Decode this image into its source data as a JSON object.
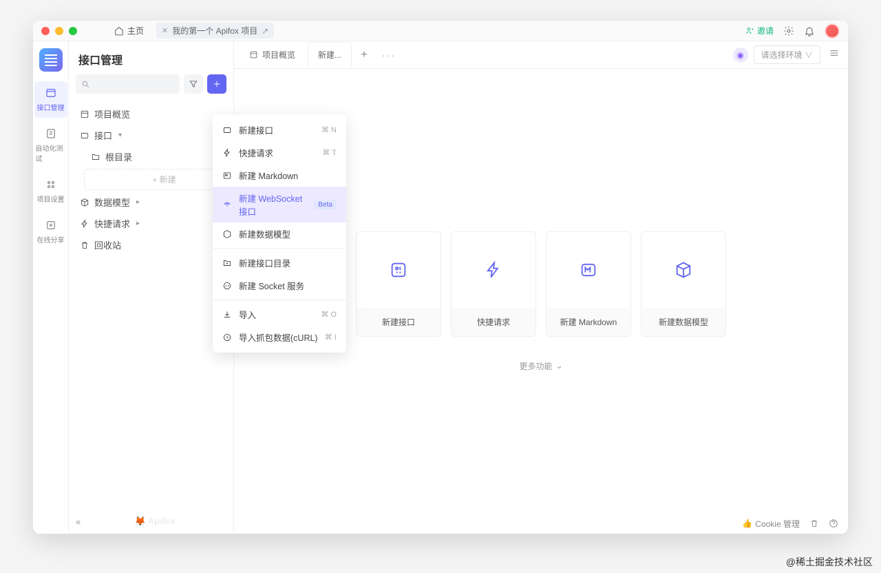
{
  "titlebar": {
    "home": "主页",
    "project_tab": "我的第一个 Apifox 项目",
    "invite": "邀请"
  },
  "nav": {
    "items": [
      "接口管理",
      "自动化测试",
      "项目设置",
      "在线分享"
    ]
  },
  "sidebar": {
    "title": "接口管理",
    "tree": {
      "overview": "项目概览",
      "interface": "接口",
      "root_dir": "根目录",
      "new_placeholder": "+ 新建",
      "data_model": "数据模型",
      "quick_request": "快捷请求",
      "recycle": "回收站"
    },
    "brand": "Apifox"
  },
  "tabs": {
    "overview": "项目概览",
    "new": "新建...",
    "env_placeholder": "请选择环境"
  },
  "dropdown": {
    "items": [
      {
        "label": "新建接口",
        "shortcut": "⌘ N"
      },
      {
        "label": "快捷请求",
        "shortcut": "⌘ T"
      },
      {
        "label": "新建 Markdown"
      },
      {
        "label": "新建 WebSocket 接口",
        "beta": "Beta",
        "highlight": true
      },
      {
        "label": "新建数据模型"
      }
    ],
    "group2": [
      {
        "label": "新建接口目录"
      },
      {
        "label": "新建 Socket 服务"
      }
    ],
    "group3": [
      {
        "label": "导入",
        "shortcut": "⌘ O"
      },
      {
        "label": "导入抓包数据(cURL)",
        "shortcut": "⌘ I"
      }
    ]
  },
  "cards": {
    "items": [
      "新建接口",
      "快捷请求",
      "新建 Markdown",
      "新建数据模型"
    ],
    "more": "更多功能"
  },
  "footer": {
    "cookie": "Cookie 管理"
  },
  "watermark": "@稀土掘金技术社区"
}
